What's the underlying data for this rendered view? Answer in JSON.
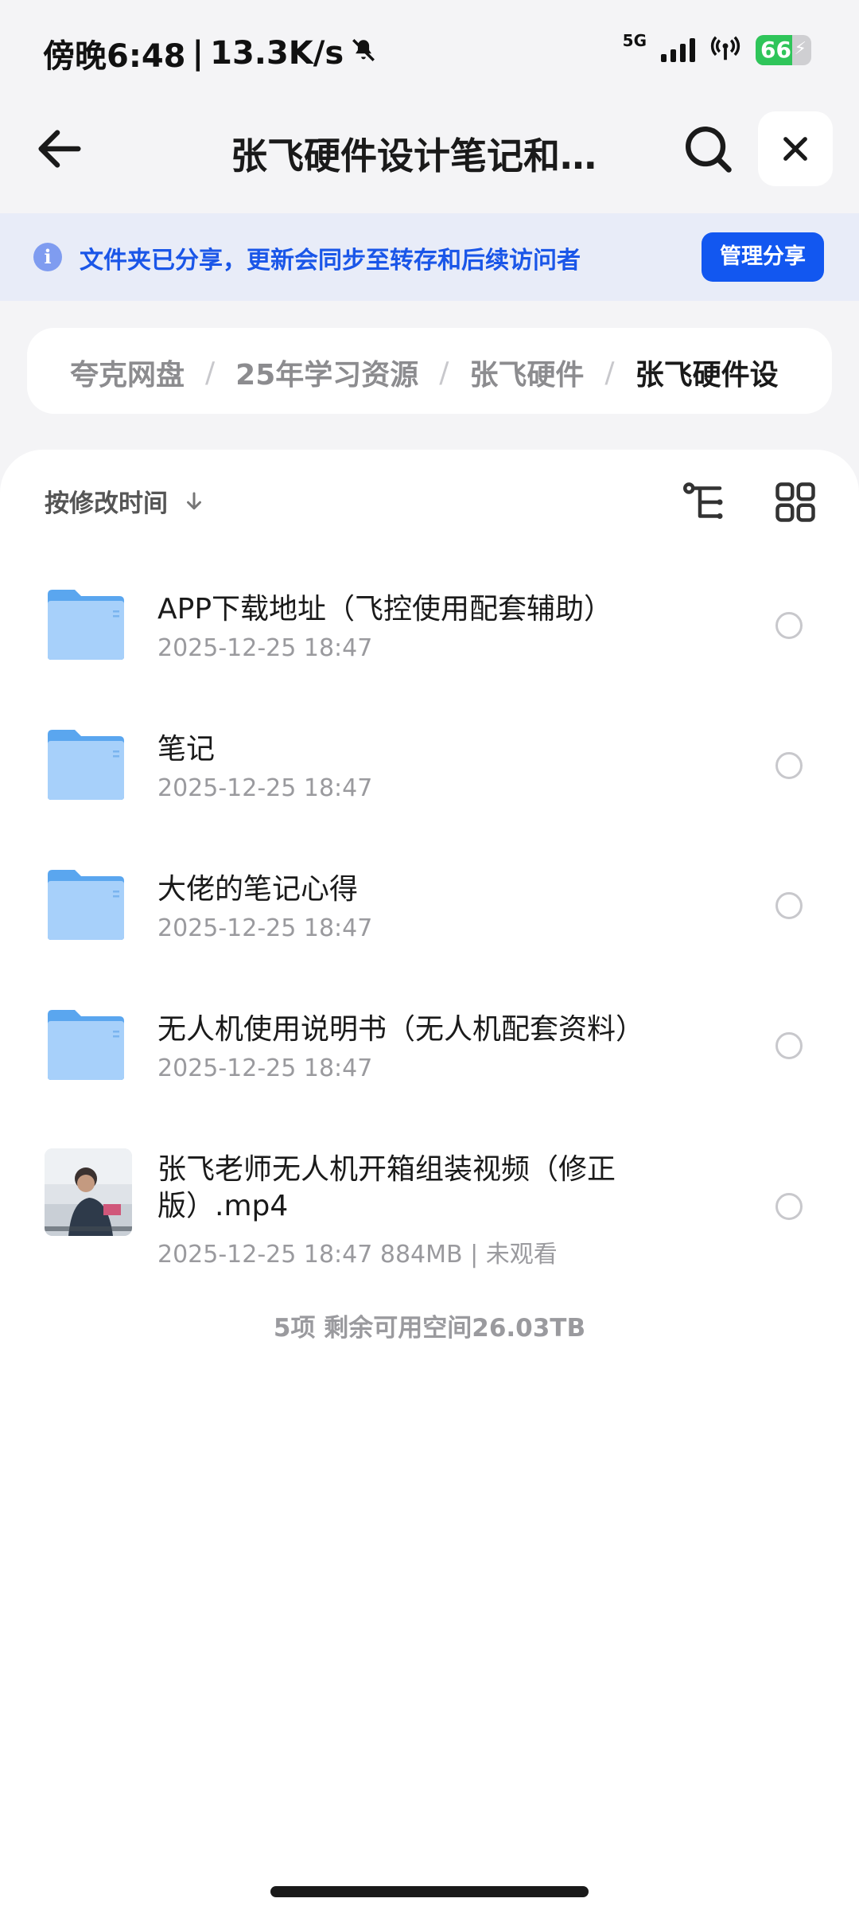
{
  "status": {
    "time": "傍晚6:48",
    "separator": "|",
    "speed": "13.3K/s",
    "network": "5G",
    "battery": "66",
    "battery_level": 0.66
  },
  "header": {
    "title": "张飞硬件设计笔记和配套资料"
  },
  "banner": {
    "text": "文件夹已分享，更新会同步至转存和后续访问者",
    "button": "管理分享"
  },
  "breadcrumb": [
    "夸克网盘",
    "25年学习资源",
    "张飞硬件",
    "张飞硬件设"
  ],
  "toolbar": {
    "sort_label": "按修改时间"
  },
  "files": [
    {
      "name": "APP下载地址（飞控使用配套辅助）",
      "meta": "2025-12-25 18:47",
      "type": "folder"
    },
    {
      "name": "笔记",
      "meta": "2025-12-25 18:47",
      "type": "folder"
    },
    {
      "name": "大佬的笔记心得",
      "meta": "2025-12-25 18:47",
      "type": "folder"
    },
    {
      "name": "无人机使用说明书（无人机配套资料）",
      "meta": "2025-12-25 18:47",
      "type": "folder"
    },
    {
      "name": "张飞老师无人机开箱组装视频（修正版）.mp4",
      "meta": "2025-12-25 18:47  884MB | 未观看",
      "type": "video"
    }
  ],
  "footer": {
    "summary": "5项 剩余可用空间26.03TB"
  },
  "colors": {
    "accent": "#1257f0",
    "banner_bg": "#e8ecf8",
    "folder": "#7cb9f5"
  }
}
